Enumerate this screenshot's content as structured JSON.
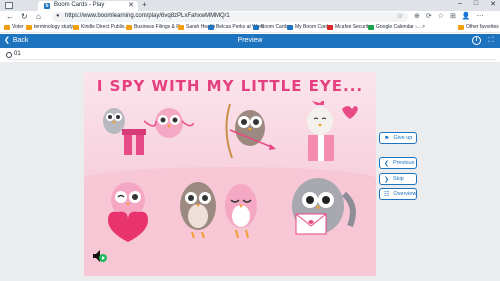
{
  "browser": {
    "tab_title": "Boom Cards - Play",
    "new_tab": "+",
    "url": "https://www.boomlearning.com/play/6vq8zPLxFahxwMMMQ/1",
    "win_controls": [
      "–",
      "□",
      "✕"
    ],
    "tab_close": "✕",
    "back": "←",
    "refresh": "↻",
    "home": "⌂",
    "lock": "🔒",
    "star": "☆",
    "tools": [
      "⊕",
      "⟳",
      "☆",
      "⊞",
      "👤",
      "⋯"
    ]
  },
  "bookmarks": {
    "items": [
      {
        "label": "Voter",
        "color": "#f59e0b"
      },
      {
        "label": "terminology study",
        "color": "#f59e0b"
      },
      {
        "label": "Kindle Direct Publis...",
        "color": "#f59e0b"
      },
      {
        "label": "Business Filings & R...",
        "color": "#f59e0b"
      },
      {
        "label": "Sarah Health",
        "color": "#f59e0b"
      },
      {
        "label": "Belcas Perks at Work",
        "color": "#1e73be"
      },
      {
        "label": "Boom Cards",
        "color": "#1e73be"
      },
      {
        "label": "My Boom Cards",
        "color": "#1e73be"
      },
      {
        "label": "Mcafee Security",
        "color": "#dc2626"
      },
      {
        "label": "Google Calendar -...",
        "color": "#16a34a"
      }
    ],
    "overflow": ">",
    "other": "Other favorites"
  },
  "header": {
    "back_label": "Back",
    "title": "Preview",
    "info": "i",
    "fullscreen": "⛶"
  },
  "timer": {
    "value": "01"
  },
  "card": {
    "title": "I SPY WITH MY LITTLE EYE..."
  },
  "side_buttons": {
    "give_up": "Give up",
    "previous": "Previous",
    "skip": "Skip",
    "overview": "Overview"
  },
  "colors": {
    "brand_blue": "#1e73be",
    "title_pink": "#e4407f",
    "card_bg": "#fbe4ec"
  }
}
